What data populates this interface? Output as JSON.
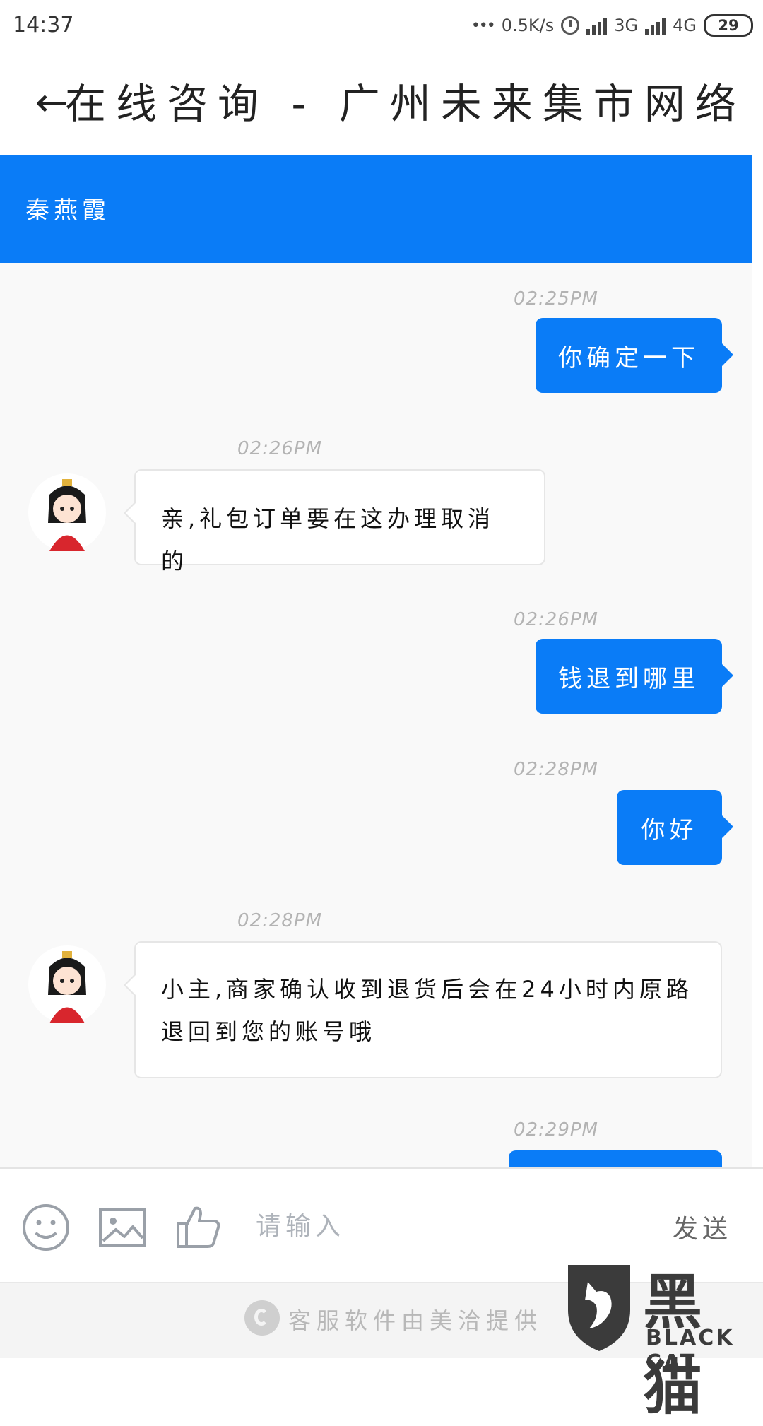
{
  "status_bar": {
    "time": "14:37",
    "net_speed": "0.5K/s",
    "network_1": "3G",
    "network_2": "4G",
    "battery": "29"
  },
  "header": {
    "title": "在线咨询 - 广州未来集市网络"
  },
  "agent": {
    "name": "秦燕霞"
  },
  "messages": [
    {
      "time": "02:25PM",
      "direction": "out",
      "text": "你确定一下"
    },
    {
      "time": "02:26PM",
      "direction": "in",
      "text": "亲,礼包订单要在这办理取消的"
    },
    {
      "time": "02:26PM",
      "direction": "out",
      "text": "钱退到哪里"
    },
    {
      "time": "02:28PM",
      "direction": "out",
      "text": "你好"
    },
    {
      "time": "02:28PM",
      "direction": "in",
      "text": "小主,商家确认收到退货后会在24小时内原路退回到您的账号哦"
    },
    {
      "time": "02:29PM",
      "direction": "out",
      "text": ""
    }
  ],
  "input_bar": {
    "placeholder": "请输入",
    "send_label": "发送",
    "icons": [
      "emoji-icon",
      "image-icon",
      "thumbs-up-icon"
    ]
  },
  "footer": {
    "text": "客服软件由美洽提供"
  },
  "watermark": {
    "cn": "黑猫",
    "en": "BLACK CAT"
  },
  "colors": {
    "accent": "#0a7cf7",
    "chat_bg": "#f9f9f9",
    "timestamp": "#b3b3b3"
  }
}
